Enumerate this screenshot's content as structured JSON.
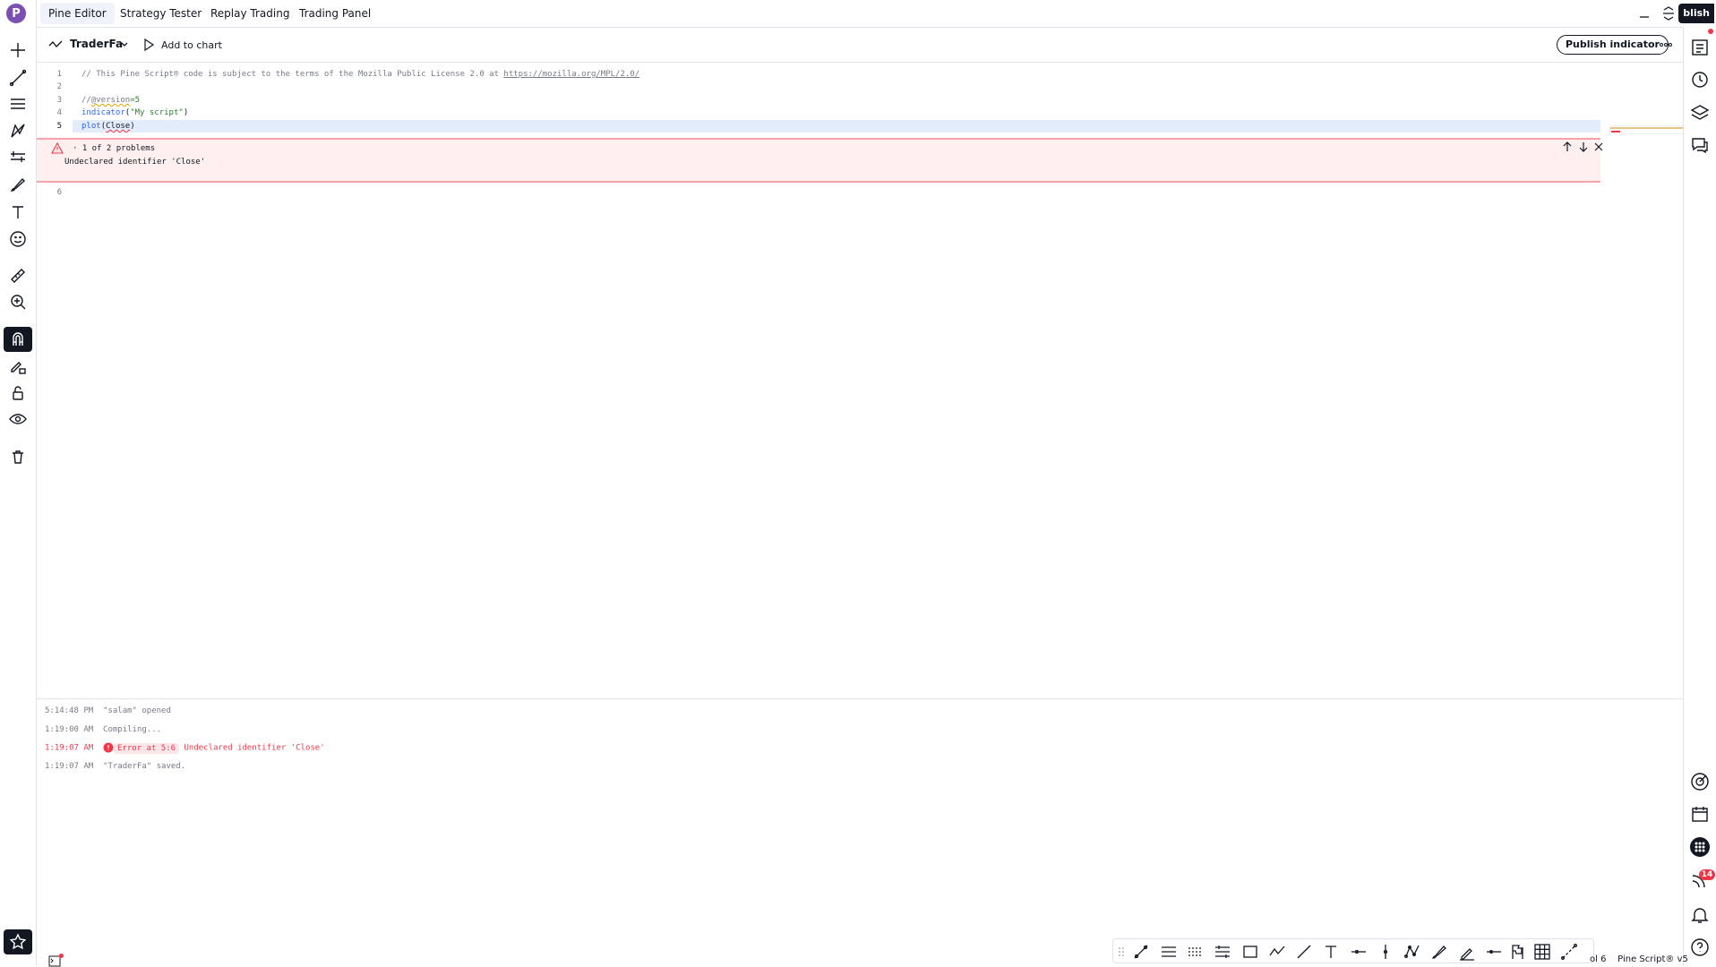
{
  "sidebar": {
    "avatar_letter": "P"
  },
  "tabs": [
    {
      "label": "Pine Editor",
      "active": true
    },
    {
      "label": "Strategy Tester"
    },
    {
      "label": "Replay Trading"
    },
    {
      "label": "Trading Panel"
    }
  ],
  "top_right_label": "blish",
  "editor": {
    "script_name": "TraderFa",
    "add_to_chart_label": "Add to chart",
    "publish_label": "Publish indicator",
    "lines": [
      {
        "n": "1",
        "text": "// This Pine Script® code is subject to the terms of the Mozilla Public License 2.0 at ",
        "link": "https://mozilla.org/MPL/2.0/"
      },
      {
        "n": "2",
        "text": ""
      },
      {
        "n": "3",
        "comment_prefix": "//",
        "annotation": "@version",
        "value": "=5"
      },
      {
        "n": "4",
        "fn": "indicator",
        "arg": "\"My script\""
      },
      {
        "n": "5",
        "fn": "plot",
        "arg": "Close"
      },
      {
        "n": "6",
        "text": ""
      }
    ],
    "problem": {
      "counter": "· 1 of 2 problems",
      "message": "Undeclared identifier 'Close'"
    }
  },
  "console": {
    "logs": [
      {
        "time": "5:14:48 PM",
        "message": "\"salam\" opened"
      },
      {
        "time": "1:19:00 AM",
        "message": "Compiling..."
      },
      {
        "time": "1:19:07 AM",
        "badge": "Error at 5:6",
        "message": "Undeclared identifier 'Close'"
      },
      {
        "time": "1:19:07 AM",
        "message": "\"TraderFa\" saved."
      }
    ]
  },
  "right_toolbar": {
    "notification_count": "14"
  },
  "status_bar": {
    "line": "ol 6",
    "language": "Pine Script® v5"
  },
  "colors": {
    "error": "#f23645",
    "accent": "#2962ff",
    "line_highlight": "#e3ecfb"
  }
}
